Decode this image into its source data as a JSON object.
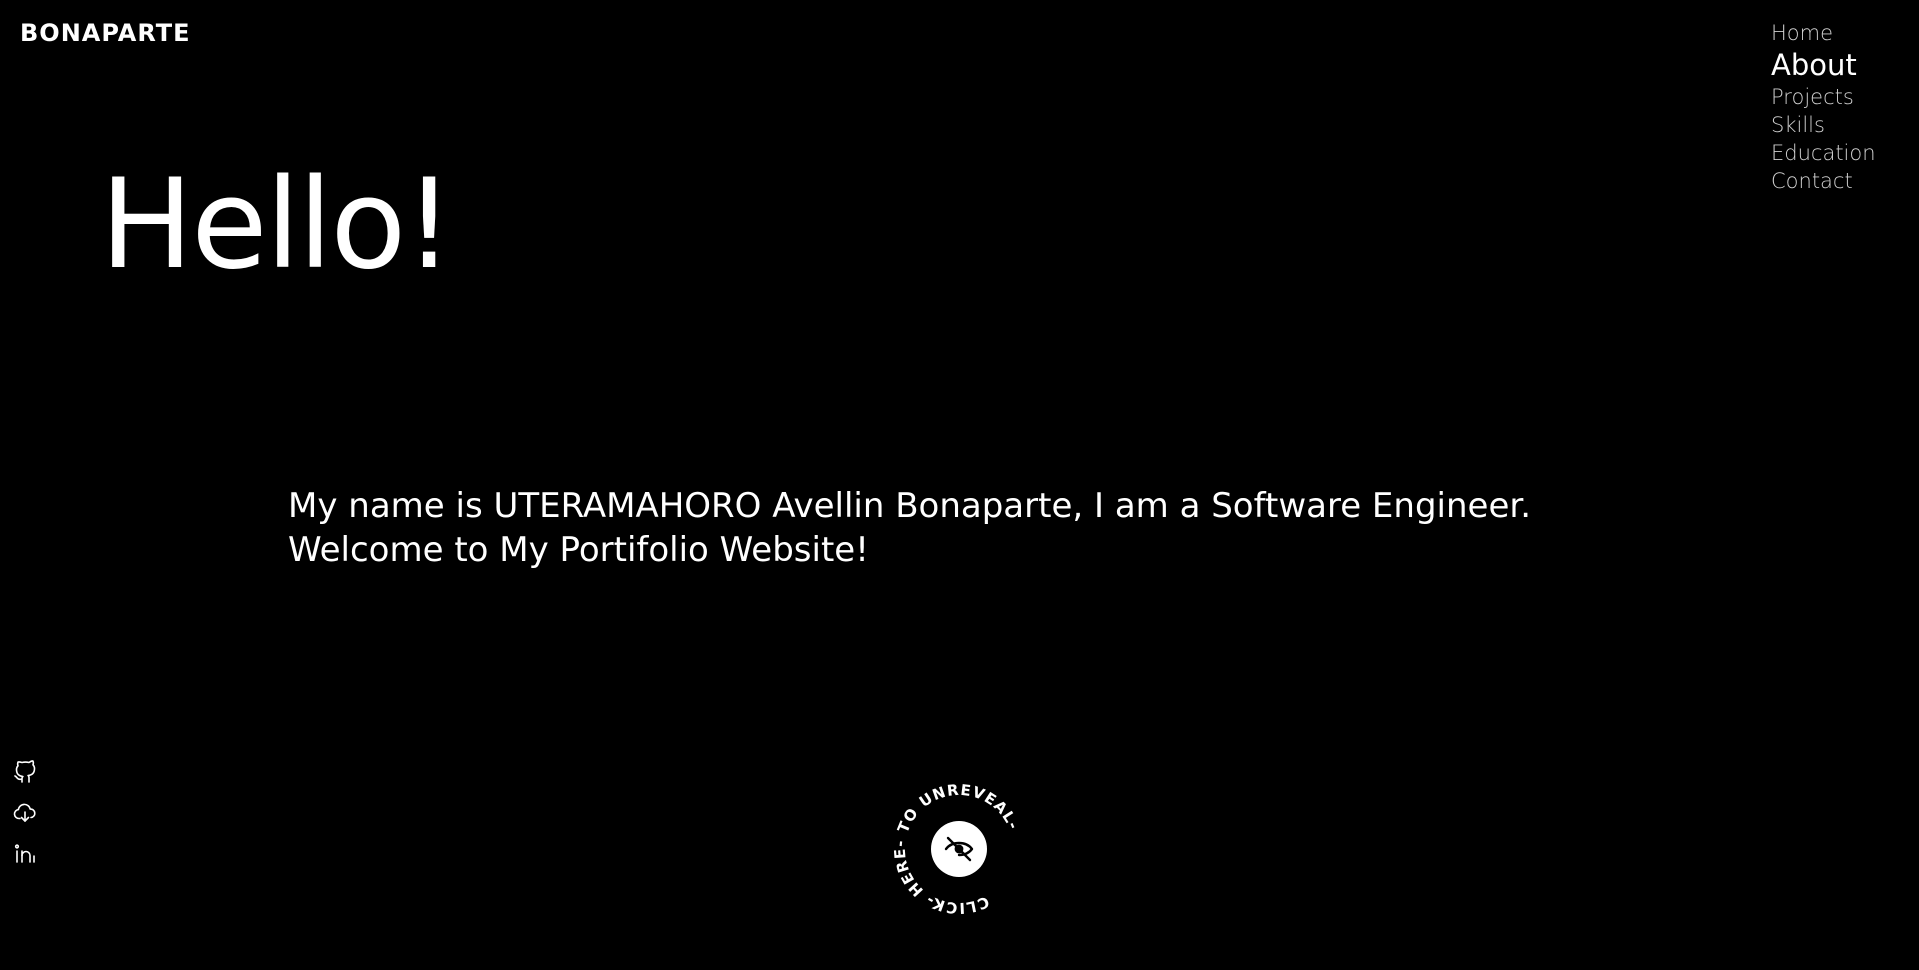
{
  "logo": {
    "text": "BONAPARTE"
  },
  "nav": {
    "items": [
      {
        "label": "Home",
        "active": false
      },
      {
        "label": "About",
        "active": true
      },
      {
        "label": "Projects",
        "active": false
      },
      {
        "label": "Skills",
        "active": false
      },
      {
        "label": "Education",
        "active": false
      },
      {
        "label": "Contact",
        "active": false
      }
    ]
  },
  "hero": {
    "title": "Hello!",
    "intro_line1": "My name is UTERAMAHORO Avellin Bonaparte, I am a Software Engineer.",
    "intro_line2": "Welcome to My Portifolio Website!"
  },
  "social": {
    "icons": [
      "github-icon",
      "cloud-download-icon",
      "linkedin-icon"
    ]
  },
  "reveal": {
    "circular_text": "CLICK- HERE- TO UNREVEAL- ",
    "icon": "eye-off-icon"
  },
  "colors": {
    "background": "#000000",
    "text": "#ffffff",
    "nav_inactive": "#cfcfcf"
  }
}
